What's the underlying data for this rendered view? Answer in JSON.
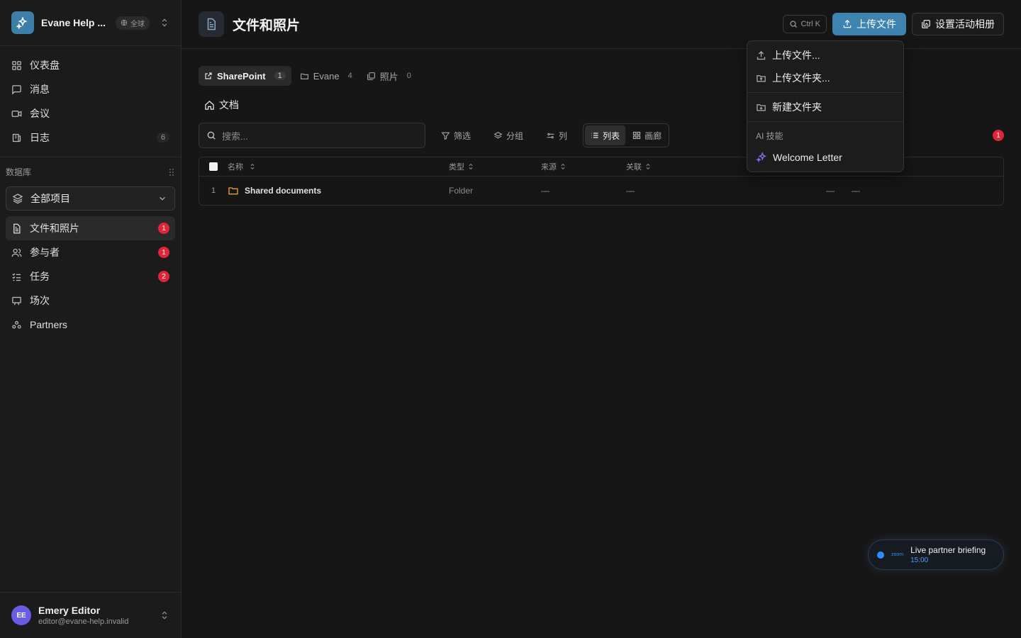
{
  "workspace": {
    "name": "Evane Help ...",
    "scope": "全球"
  },
  "nav": [
    {
      "label": "仪表盘",
      "icon": "dashboard-icon"
    },
    {
      "label": "消息",
      "icon": "message-icon"
    },
    {
      "label": "会议",
      "icon": "video-icon"
    },
    {
      "label": "日志",
      "icon": "log-icon",
      "count": "6"
    }
  ],
  "database": {
    "heading": "数据库",
    "selected": "全部项目",
    "items": [
      {
        "label": "文件和照片",
        "badge": "1"
      },
      {
        "label": "参与者",
        "badge": "1"
      },
      {
        "label": "任务",
        "badge": "2"
      },
      {
        "label": "场次"
      },
      {
        "label": "Partners"
      }
    ]
  },
  "user": {
    "initials": "EE",
    "name": "Emery Editor",
    "email": "editor@evane-help.invalid"
  },
  "header": {
    "title": "文件和照片",
    "shortcut": "Ctrl K",
    "upload_label": "上传文件",
    "album_label": "设置活动相册"
  },
  "tabs": [
    {
      "label": "SharePoint",
      "count": "1"
    },
    {
      "label": "Evane",
      "count": "4"
    },
    {
      "label": "照片",
      "count": "0"
    }
  ],
  "breadcrumb": "文档",
  "toolbar": {
    "search_placeholder": "搜索...",
    "filter": "筛选",
    "group": "分组",
    "columns": "列",
    "view_list": "列表",
    "view_gallery": "画廊",
    "filter_badge": "1"
  },
  "table": {
    "headers": {
      "name": "名称",
      "type": "类型",
      "source": "来源",
      "relation": "关联"
    },
    "rows": [
      {
        "num": "1",
        "name": "Shared documents",
        "type": "Folder",
        "source": "—",
        "relation": "—",
        "extra1": "—",
        "extra2": "—"
      }
    ]
  },
  "dropdown": {
    "upload_file": "上传文件...",
    "upload_folder": "上传文件夹...",
    "new_folder": "新建文件夹",
    "ai_label": "AI 技能",
    "welcome": "Welcome Letter"
  },
  "toast": {
    "brand": "zoom",
    "title": "Live partner briefing",
    "time": "15:00"
  },
  "colors": {
    "accent": "#3d84b0",
    "badge_red": "#e0243a",
    "avatar": "#6b5ce7",
    "folder": "#e8a23a",
    "ai": "#8b6cf0"
  }
}
